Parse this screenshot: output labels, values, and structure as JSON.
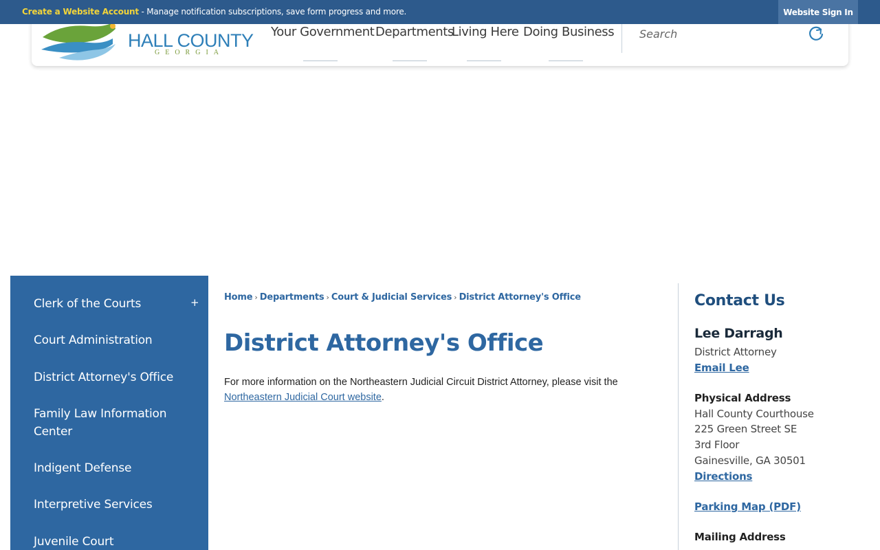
{
  "topbar": {
    "create_account": "Create a Website Account",
    "message": " - Manage notification subscriptions, save form progress and more.",
    "sign_in": "Website Sign In"
  },
  "logo": {
    "name": "HALL COUNTY",
    "sub": "GEORGIA"
  },
  "nav": {
    "items": [
      {
        "label": "Your Government"
      },
      {
        "label": "Departments"
      },
      {
        "label": "Living Here"
      },
      {
        "label": "Doing Business"
      }
    ]
  },
  "search": {
    "placeholder": "Search"
  },
  "sidebar": {
    "toggle": "+",
    "items": [
      {
        "label": "Clerk of the Courts"
      },
      {
        "label": "Court Administration"
      },
      {
        "label": "District Attorney's Office"
      },
      {
        "label": "Family Law Information Center"
      },
      {
        "label": "Indigent Defense"
      },
      {
        "label": "Interpretive Services"
      },
      {
        "label": "Juvenile Court"
      }
    ]
  },
  "breadcrumb": {
    "items": [
      {
        "label": "Home"
      },
      {
        "label": "Departments"
      },
      {
        "label": "Court & Judicial Services"
      },
      {
        "label": "District Attorney's Office"
      }
    ],
    "separator": "›"
  },
  "main": {
    "title": "District Attorney's Office",
    "body_prefix": "For more information on the Northeastern Judicial Circuit District Attorney, please visit the ",
    "body_link": "Northeastern Judicial Court website",
    "body_suffix": "."
  },
  "contact": {
    "title": "Contact Us",
    "name": "Lee Darragh",
    "role": "District Attorney",
    "email_label": "Email Lee",
    "physical_heading": "Physical Address",
    "address_lines": [
      "Hall County Courthouse",
      "225 Green Street SE",
      "3rd Floor",
      "Gainesville, GA 30501"
    ],
    "directions": "Directions",
    "parking": "Parking Map (PDF)",
    "mailing_heading": "Mailing Address"
  },
  "colors": {
    "brand_blue": "#2e67a1",
    "topbar": "#2d5a8c",
    "highlight_yellow": "#f2d43a"
  }
}
